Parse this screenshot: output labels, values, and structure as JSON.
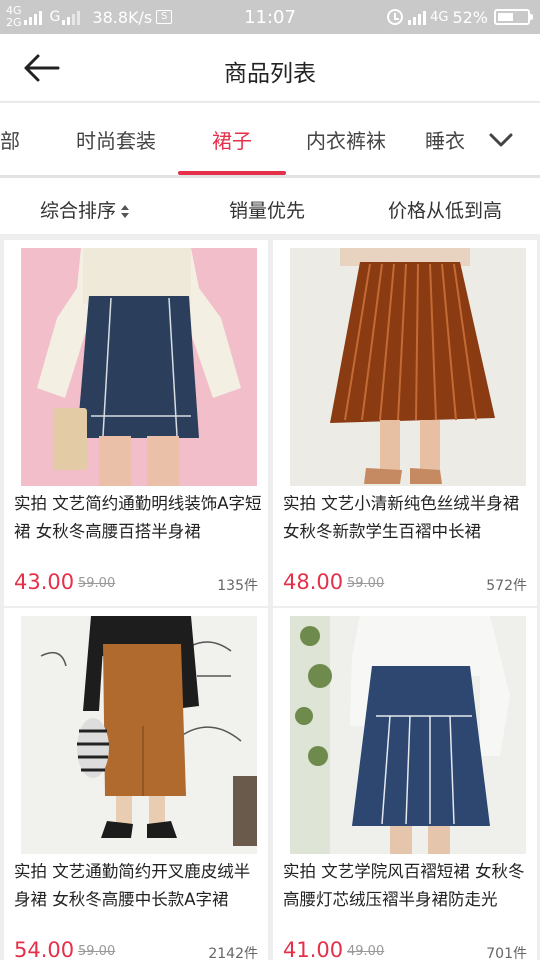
{
  "status_bar": {
    "net_top": "4G",
    "net_bottom": "2G",
    "g_label": "G",
    "speed": "38.8K/s",
    "s_badge": "S",
    "time": "11:07",
    "net_right": "4G",
    "battery": "52%",
    "battery_level": 0.52
  },
  "header": {
    "title": "商品列表"
  },
  "tabs": {
    "items": [
      "全部",
      "时尚套装",
      "裙子",
      "内衣裤袜",
      "睡衣"
    ],
    "active_index": 2,
    "accent_color": "#e5304a"
  },
  "sort": {
    "items": [
      "综合排序",
      "销量优先",
      "价格从低到高"
    ]
  },
  "products": [
    {
      "name": "实拍 文艺简约通勤明线装饰A字短裙 女秋冬高腰百搭半身裙",
      "price": "43.00",
      "old_price": "59.00",
      "sold": "135件"
    },
    {
      "name": "实拍 文艺小清新纯色丝绒半身裙 女秋冬新款学生百褶中长裙",
      "price": "48.00",
      "old_price": "59.00",
      "sold": "572件"
    },
    {
      "name": "实拍 文艺通勤简约开叉鹿皮绒半身裙 女秋冬高腰中长款A字裙",
      "price": "54.00",
      "old_price": "59.00",
      "sold": "2142件"
    },
    {
      "name": "实拍 文艺学院风百褶短裙 女秋冬高腰灯芯绒压褶半身裙防走光",
      "price": "41.00",
      "old_price": "49.00",
      "sold": "701件"
    }
  ]
}
